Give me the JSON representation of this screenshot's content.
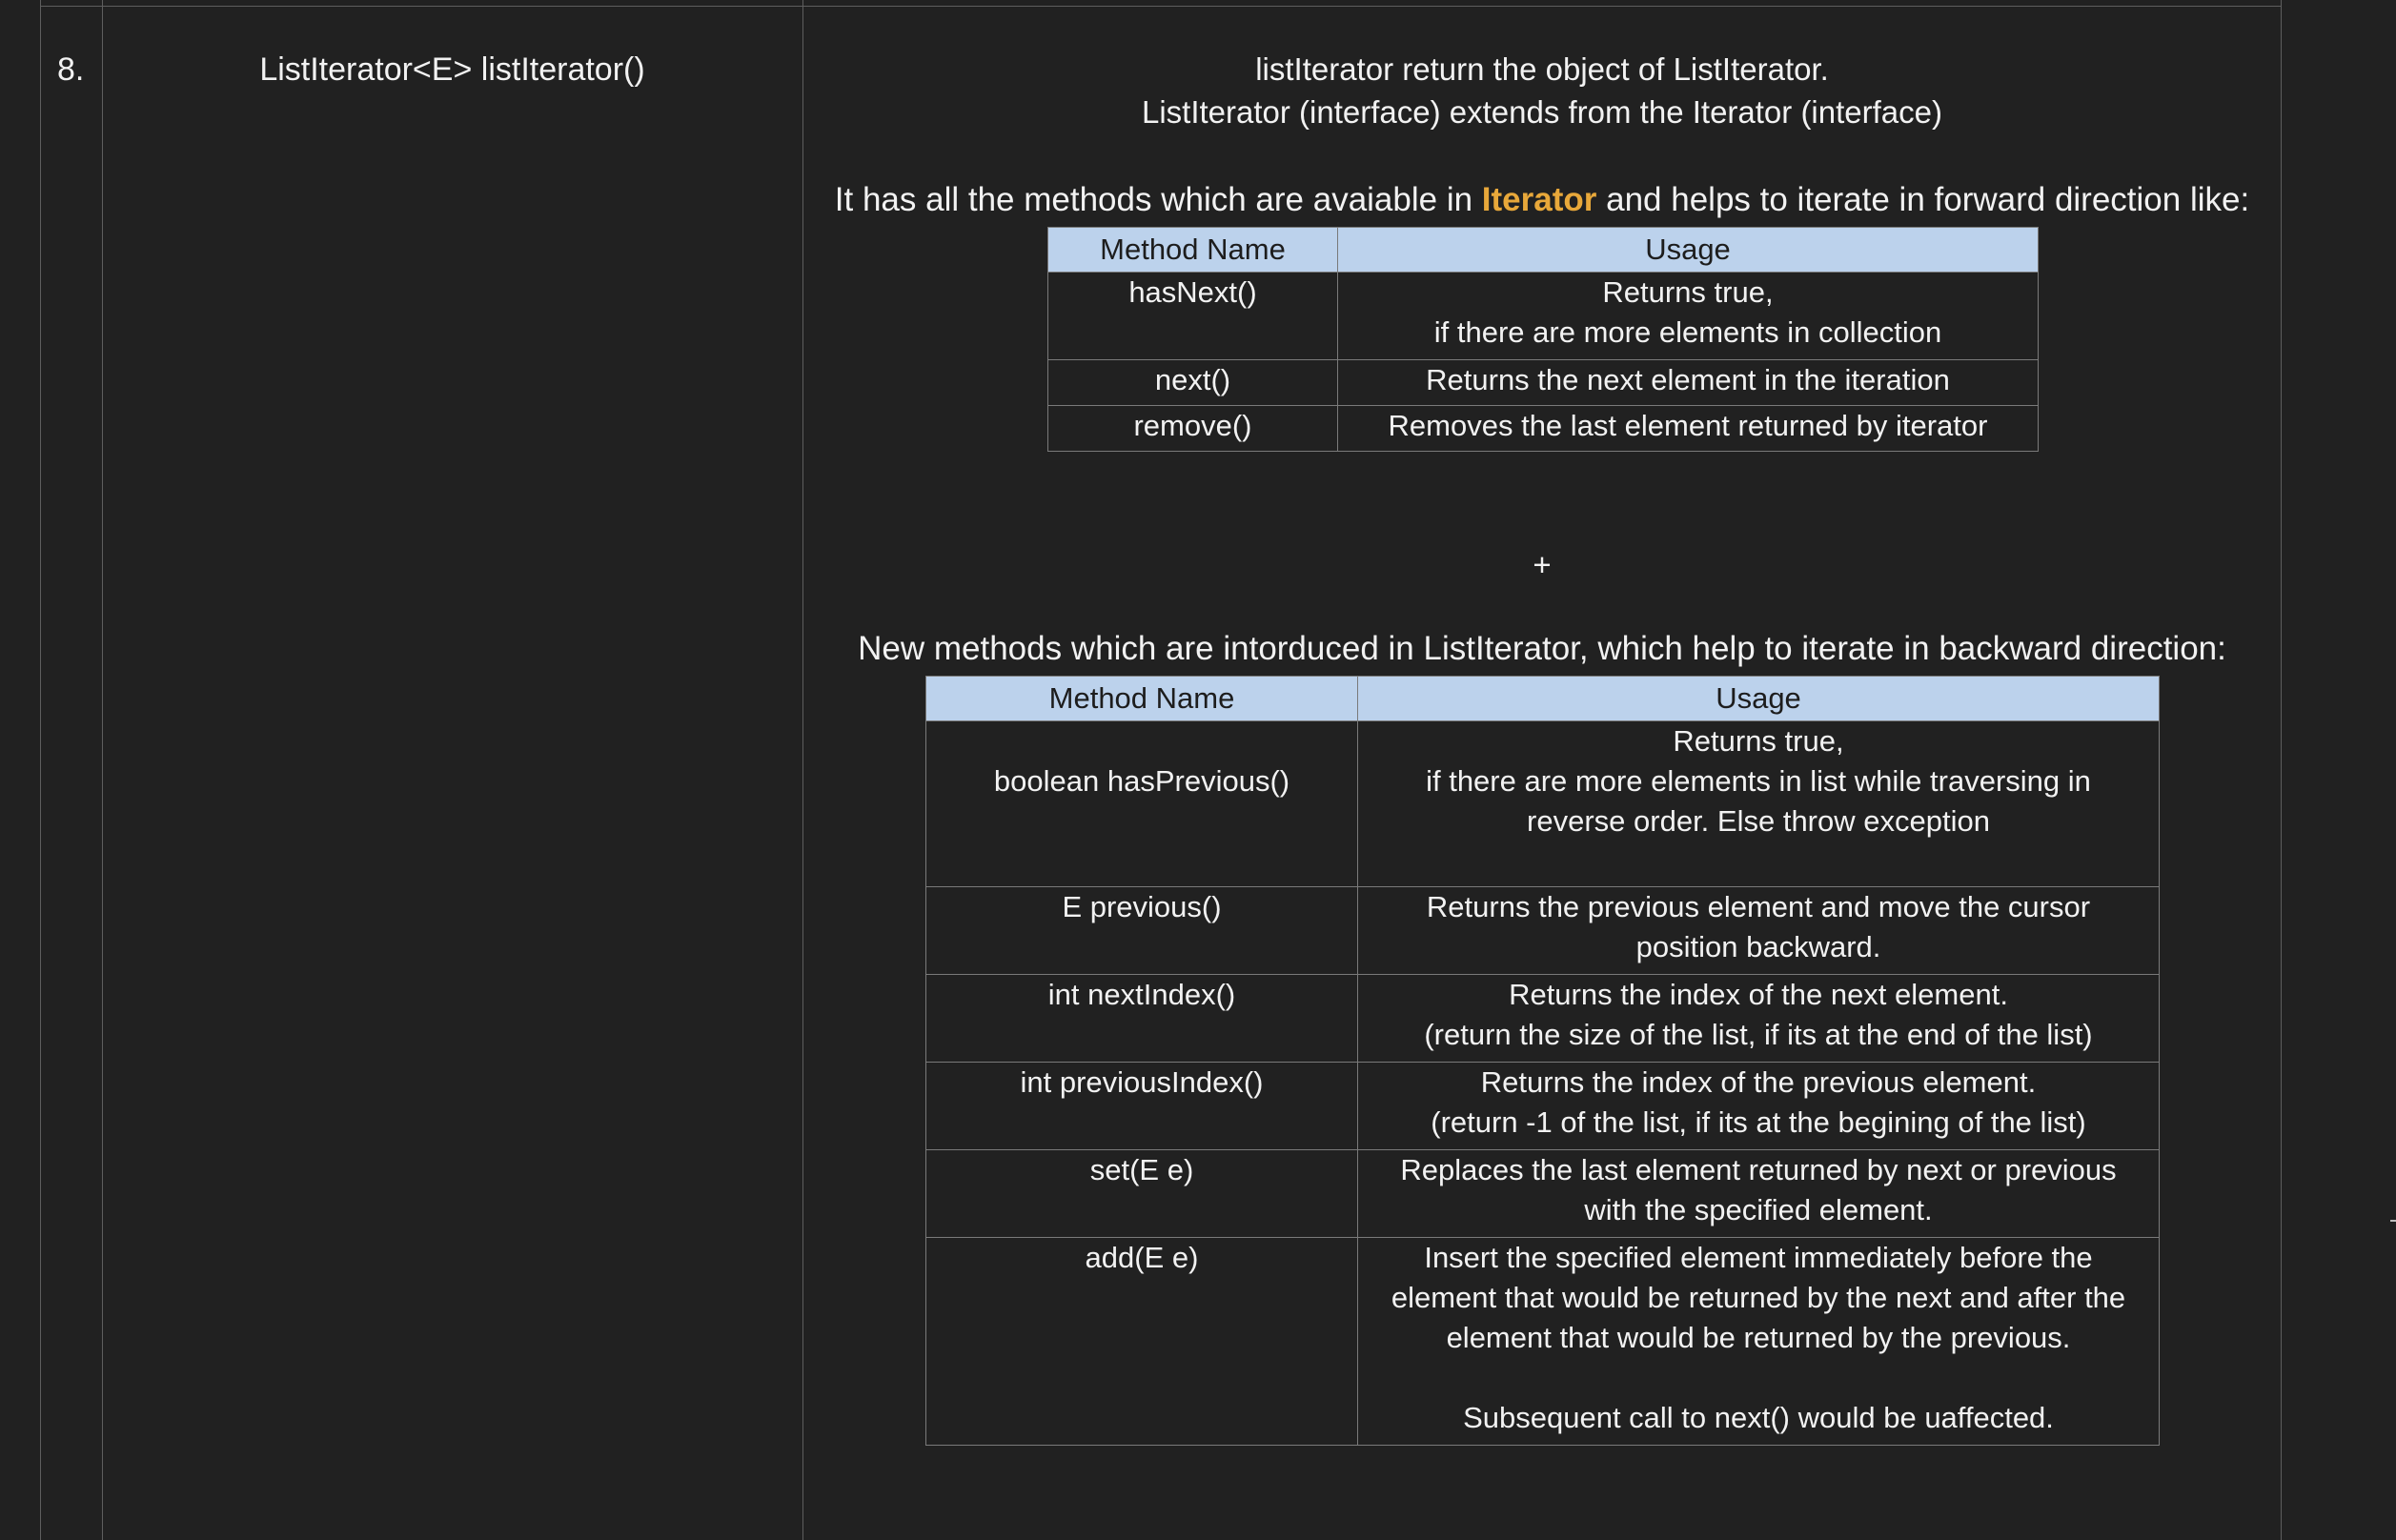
{
  "row": {
    "number": "8.",
    "signature": "ListIterator<E> listIterator()"
  },
  "description": {
    "line1": "listIterator return the object of ListIterator.",
    "line2": "ListIterator (interface) extends from the Iterator (interface)",
    "intro_before": "It has all the methods which are avaiable in ",
    "intro_highlight": "Iterator",
    "intro_after": " and helps to iterate in forward direction like:",
    "plus": "+",
    "new_methods_heading": "New methods which are intorduced in ListIterator, which help to iterate in backward direction:"
  },
  "iterator_table": {
    "headers": [
      "Method Name",
      "Usage"
    ],
    "rows": [
      {
        "method": "hasNext()",
        "usage": "Returns true,\nif there are more elements in collection"
      },
      {
        "method": "next()",
        "usage": "Returns the next element in the iteration"
      },
      {
        "method": "remove()",
        "usage": "Removes the last element returned by iterator"
      }
    ]
  },
  "listiterator_table": {
    "headers": [
      "Method Name",
      "Usage"
    ],
    "rows": [
      {
        "method": "boolean hasPrevious()",
        "usage": "Returns true,\nif there are more elements in list while traversing in\nreverse order. Else throw exception"
      },
      {
        "method": "E previous()",
        "usage": "Returns the previous element and move the cursor\nposition backward."
      },
      {
        "method": "int nextIndex()",
        "usage": "Returns the index of the next element.\n(return the size of the list, if its at the end of the list)"
      },
      {
        "method": "int previousIndex()",
        "usage": "Returns the index of the previous element.\n(return -1 of the list, if its at the begining of the list)"
      },
      {
        "method": "set(E e)",
        "usage": "Replaces the last element returned by next or previous\nwith the specified element."
      },
      {
        "method": "add(E e)",
        "usage": "Insert the specified element immediately before the\nelement that would be returned by the next and after the\nelement that would be returned by the previous.\n\nSubsequent call to next() would be uaffected."
      }
    ]
  },
  "colors": {
    "background": "#212121",
    "header_fill": "#bcd2ec",
    "highlight": "#e8a83a"
  }
}
